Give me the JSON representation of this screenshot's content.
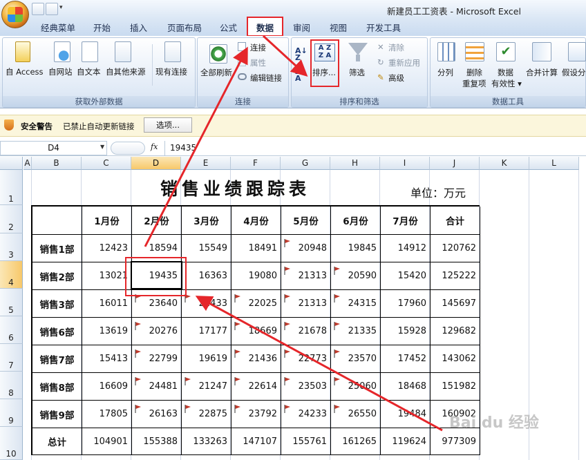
{
  "window": {
    "title": "新建员工工资表 - Microsoft Excel"
  },
  "tabs": [
    "经典菜单",
    "开始",
    "插入",
    "页面布局",
    "公式",
    "数据",
    "审阅",
    "视图",
    "开发工具"
  ],
  "ribbon": {
    "external": {
      "group": "获取外部数据",
      "access": "自 Access",
      "web": "自网站",
      "text": "自文本",
      "other": "自其他来源",
      "existing": "现有连接"
    },
    "connections": {
      "group": "连接",
      "refresh_all": "全部刷新",
      "connections": "连接",
      "properties": "属性",
      "edit_links": "编辑链接"
    },
    "sort_filter": {
      "group": "排序和筛选",
      "sort": "排序...",
      "filter": "筛选",
      "clear": "清除",
      "reapply": "重新应用",
      "advanced": "高级"
    },
    "data_tools": {
      "group": "数据工具",
      "text_to_columns": "分列",
      "remove_dup_1": "删除",
      "remove_dup_2": "重复项",
      "validation_1": "数据",
      "validation_2": "有效性 ▾",
      "consolidate": "合并计算",
      "whatif": "假设分"
    }
  },
  "security_bar": {
    "label": "安全警告",
    "message": "已禁止自动更新链接",
    "options_button": "选项..."
  },
  "formula_bar": {
    "name_box": "D4",
    "fx": "fx",
    "value": "19435"
  },
  "columns": [
    "A",
    "B",
    "C",
    "D",
    "E",
    "F",
    "G",
    "H",
    "I",
    "J",
    "K",
    "L"
  ],
  "rows": [
    "1",
    "2",
    "3",
    "4",
    "5",
    "6",
    "7",
    "8",
    "9",
    "10"
  ],
  "sheet": {
    "title": "销售业绩跟踪表",
    "unit": "单位：万元",
    "headers": [
      "",
      "1月份",
      "2月份",
      "3月份",
      "4月份",
      "5月份",
      "6月份",
      "7月份",
      "合计"
    ],
    "data": [
      [
        "销售1部",
        "12423",
        "18594",
        "15549",
        "18491",
        "20948",
        "19845",
        "14912",
        "120762"
      ],
      [
        "销售2部",
        "13021",
        "19435",
        "16363",
        "19080",
        "21313",
        "20590",
        "15420",
        "125222"
      ],
      [
        "销售3部",
        "16011",
        "23640",
        "21433",
        "22025",
        "21313",
        "24315",
        "17960",
        "145697"
      ],
      [
        "销售6部",
        "13619",
        "20276",
        "17177",
        "18669",
        "21678",
        "21335",
        "15928",
        "129682"
      ],
      [
        "销售7部",
        "15413",
        "22799",
        "19619",
        "21436",
        "22773",
        "23570",
        "17452",
        "143062"
      ],
      [
        "销售8部",
        "16609",
        "24481",
        "21247",
        "22614",
        "23503",
        "25060",
        "18468",
        "151982"
      ],
      [
        "销售9部",
        "17805",
        "26163",
        "22875",
        "23792",
        "24233",
        "26550",
        "19484",
        "160902"
      ],
      [
        "总计",
        "104901",
        "155388",
        "133263",
        "147107",
        "155761",
        "161265",
        "119624",
        "977309"
      ]
    ]
  },
  "watermark": "Bai du 经验",
  "colors": {
    "highlight": "#e5262a",
    "selection": "#f7c86a"
  }
}
